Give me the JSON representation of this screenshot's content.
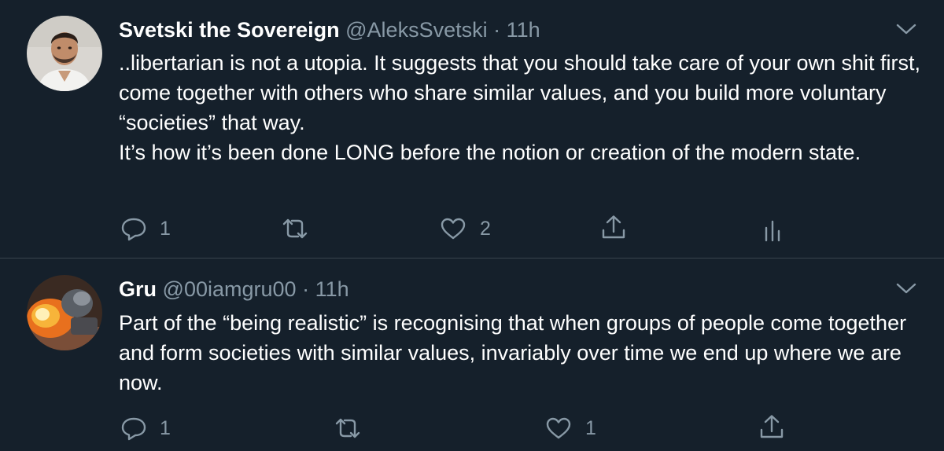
{
  "tweets": [
    {
      "display_name": "Svetski the Sovereign",
      "handle": "@AleksSvetski",
      "separator": "·",
      "time": "11h",
      "paragraphs": [
        "..libertarian is not a utopia. It suggests that you should take care of your own shit first, come together with others who share similar values, and you build more voluntary “societies” that way.",
        "It’s how it’s been done LONG before the notion or creation of the modern state."
      ],
      "reply_count": "1",
      "retweet_count": "",
      "like_count": "2",
      "icons": [
        "reply-icon",
        "retweet-icon",
        "like-icon",
        "share-icon",
        "analytics-icon"
      ]
    },
    {
      "display_name": "Gru",
      "handle": "@00iamgru00",
      "separator": "·",
      "time": "11h",
      "paragraphs": [
        "Part of the “being realistic” is recognising that when groups of people come together and form societies with similar values, invariably over time we end up where we are now."
      ],
      "reply_count": "1",
      "retweet_count": "",
      "like_count": "1",
      "icons": [
        "reply-icon",
        "retweet-icon",
        "like-icon",
        "share-icon"
      ]
    }
  ],
  "colors": {
    "background": "#15202b",
    "text_primary": "#ffffff",
    "text_secondary": "#8899a6",
    "divider": "#38444d",
    "thread_line": "#3d5466"
  }
}
